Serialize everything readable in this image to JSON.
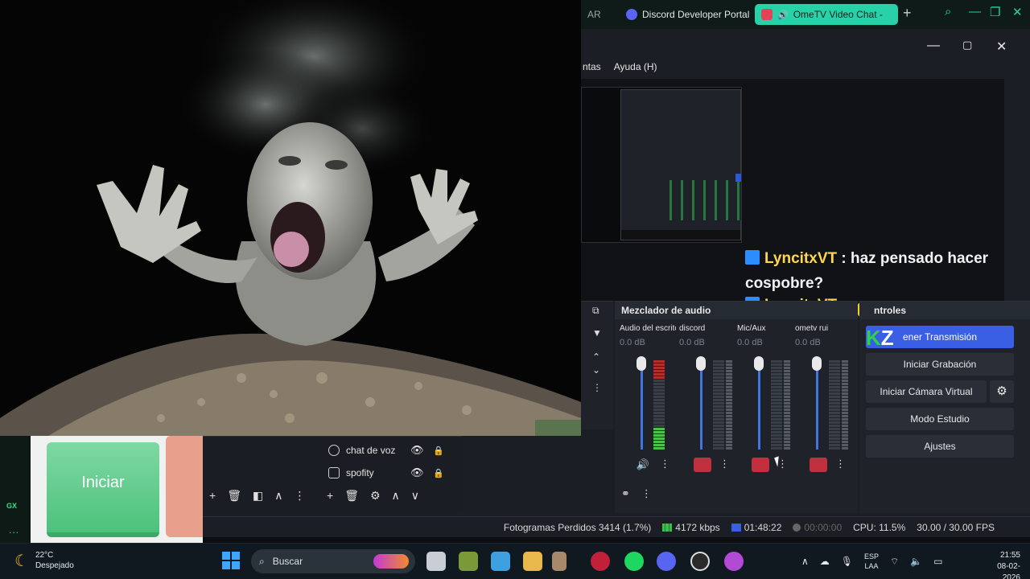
{
  "colors": {
    "accent_blue": "#3a5fe5",
    "browser_accent": "#28d1a8",
    "mute_red": "#c0303e",
    "meter_green": "#4bc24b"
  },
  "sidebar": {
    "gx_label": "GX",
    "more_label": "..."
  },
  "browser": {
    "tabs": [
      {
        "label": "AR",
        "icon": "page-icon"
      },
      {
        "label": "Discord Developer Portal",
        "icon": "discord-icon"
      },
      {
        "label": "OmeTV Video Chat -",
        "icon": "ometv-icon"
      }
    ],
    "new_tab": "+"
  },
  "obs": {
    "menu": [
      "ntas",
      "Ayuda (H)"
    ],
    "chat": {
      "user1": "LyncitxVT",
      "message1": ": haz pensado hacer cospobre?",
      "user2": "LyncitxVT"
    },
    "sources": [
      {
        "name": "chat de voz",
        "icon": "person-icon"
      },
      {
        "name": "spofity",
        "icon": "window-icon"
      }
    ],
    "mixer": {
      "title": "Mezclador de audio",
      "channels": [
        {
          "name": "Audio del escritorio",
          "db": "0.0 dB",
          "level": 0.25,
          "muted": false
        },
        {
          "name": "discord",
          "db": "0.0 dB",
          "level": 0.0,
          "muted": true
        },
        {
          "name": "Mic/Aux",
          "db": "0.0 dB",
          "level": 0.0,
          "muted": true
        },
        {
          "name": "ometv rui",
          "db": "0.0 dB",
          "level": 0.0,
          "muted": true
        }
      ]
    },
    "controls": {
      "title": "ntroles",
      "badge_k": "K",
      "badge_z": "Z",
      "stop_stream": "ener Transmisión",
      "start_recording": "Iniciar Grabación",
      "start_virtual_cam": "Iniciar Cámara Virtual",
      "studio_mode": "Modo Estudio",
      "settings": "Ajustes"
    },
    "status": {
      "dropped": "Fotogramas Perdidos 3414 (1.7%)",
      "bitrate": "4172 kbps",
      "live_time": "01:48:22",
      "rec_time": "00:00:00",
      "cpu": "CPU: 11.5%",
      "fps": "30.00 / 30.00 FPS"
    }
  },
  "overlay": {
    "iniciar_label": "Iniciar"
  },
  "taskbar": {
    "weather_temp": "22°C",
    "weather_desc": "Despejado",
    "search_placeholder": "Buscar",
    "lang_top": "ESP",
    "lang_bottom": "LAA",
    "time": "21:55",
    "date": "08-02-2026"
  }
}
